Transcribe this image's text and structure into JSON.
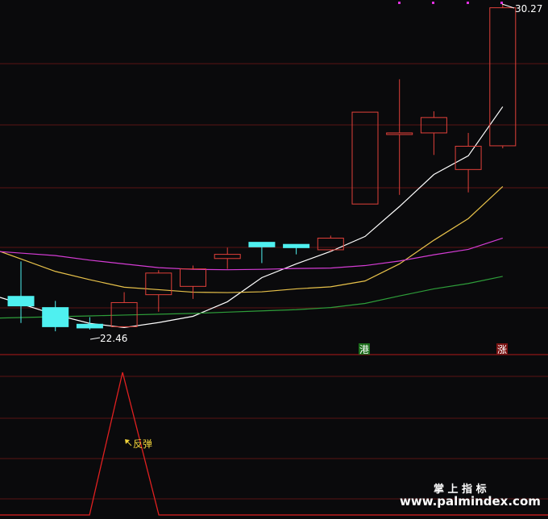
{
  "chart_data": {
    "type": "candlestick",
    "candles": [
      {
        "open": 23.26,
        "high": 24.1,
        "low": 22.62,
        "close": 23.03,
        "color": "cyan"
      },
      {
        "open": 22.99,
        "high": 23.15,
        "low": 22.42,
        "close": 22.53,
        "color": "cyan"
      },
      {
        "open": 22.59,
        "high": 22.76,
        "low": 22.46,
        "close": 22.5,
        "color": "cyan"
      },
      {
        "open": 22.53,
        "high": 23.36,
        "low": 22.53,
        "close": 23.11,
        "color": "red"
      },
      {
        "open": 23.3,
        "high": 23.89,
        "low": 22.89,
        "close": 23.82,
        "color": "red"
      },
      {
        "open": 23.5,
        "high": 24.0,
        "low": 23.2,
        "close": 23.92,
        "color": "red"
      },
      {
        "open": 24.17,
        "high": 24.43,
        "low": 23.92,
        "close": 24.27,
        "color": "red"
      },
      {
        "open": 24.45,
        "high": 24.47,
        "low": 24.06,
        "close": 24.56,
        "color": "cyan"
      },
      {
        "open": 24.43,
        "high": 24.51,
        "low": 24.27,
        "close": 24.51,
        "color": "cyan"
      },
      {
        "open": 24.38,
        "high": 24.72,
        "low": 24.34,
        "close": 24.66,
        "color": "red"
      },
      {
        "open": 25.48,
        "high": 26.55,
        "low": 25.48,
        "close": 27.69,
        "color": "red"
      },
      {
        "open": 27.16,
        "high": 28.48,
        "low": 25.7,
        "close": 27.19,
        "color": "red"
      },
      {
        "open": 27.19,
        "high": 27.71,
        "low": 26.66,
        "close": 27.56,
        "color": "red"
      },
      {
        "open": 26.31,
        "high": 27.19,
        "low": 25.76,
        "close": 26.87,
        "color": "red"
      },
      {
        "open": 26.88,
        "high": 30.27,
        "low": 26.82,
        "close": 30.2,
        "color": "red"
      }
    ],
    "ma_lines": [
      {
        "color": "#ffffff",
        "values": [
          23.08,
          22.82,
          22.61,
          22.51,
          22.63,
          22.78,
          23.13,
          23.71,
          24.04,
          24.34,
          24.7,
          25.42,
          26.19,
          26.64,
          27.82
        ]
      },
      {
        "color": "#e8c24a",
        "values": [
          24.16,
          23.86,
          23.66,
          23.48,
          23.42,
          23.36,
          23.35,
          23.37,
          23.44,
          23.49,
          23.63,
          24.04,
          24.61,
          25.13,
          25.9
        ]
      },
      {
        "color": "#d43cd4",
        "values": [
          24.3,
          24.24,
          24.13,
          24.04,
          23.95,
          23.91,
          23.9,
          23.91,
          23.93,
          23.94,
          24.0,
          24.11,
          24.26,
          24.39,
          24.66
        ]
      },
      {
        "color": "#2e9e3a",
        "values": [
          22.75,
          22.77,
          22.79,
          22.81,
          22.83,
          22.85,
          22.88,
          22.91,
          22.94,
          22.99,
          23.09,
          23.27,
          23.44,
          23.57,
          23.74
        ]
      }
    ],
    "price_range": [
      21.5,
      30.35
    ],
    "annotations": {
      "high_label": "30.27",
      "low_label": "22.46",
      "signal_label": "反弹",
      "marker_1": "港",
      "marker_2": "涨"
    },
    "indicator": {
      "values": [
        0,
        0,
        0,
        1,
        0,
        0,
        0,
        0,
        0,
        0,
        0,
        0,
        0,
        0,
        0
      ],
      "color": "#e02020"
    }
  },
  "colors": {
    "background": "#0a0a0c",
    "up": "#e0403a",
    "down": "#4ff0f0",
    "grid": "#5a1414",
    "divider": "#b01818"
  },
  "watermark": {
    "line1": "掌 上 指 标",
    "line2": "www.palmindex.com"
  }
}
